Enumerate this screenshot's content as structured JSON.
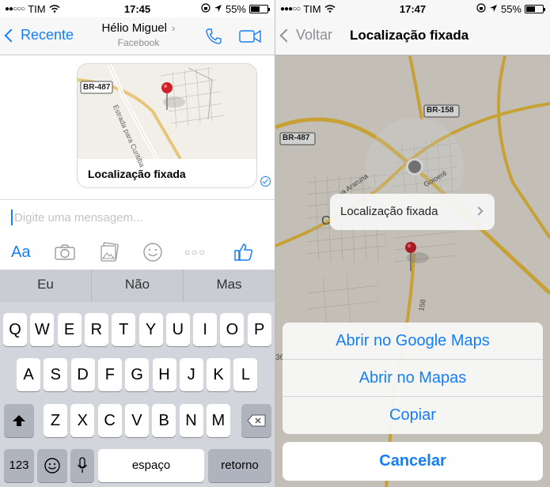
{
  "left": {
    "status": {
      "carrier": "TIM",
      "signal_dots": "●●○○○",
      "time": "17:45",
      "battery": "55%",
      "battery_level": 0.55
    },
    "nav": {
      "back_label": "Recente",
      "contact_name": "Hélio Miguel",
      "contact_sub": "Facebook"
    },
    "message": {
      "map_road_label": "BR-487",
      "map_street_label": "Estrada para Curitiba",
      "caption": "Localização fixada"
    },
    "composer": {
      "placeholder": "Digite uma mensagem..."
    },
    "tools": {
      "text_label": "Aa",
      "more_label": "○○○"
    },
    "keyboard": {
      "suggestions": [
        "Eu",
        "Não",
        "Mas"
      ],
      "row1": [
        "Q",
        "W",
        "E",
        "R",
        "T",
        "Y",
        "U",
        "I",
        "O",
        "P"
      ],
      "row2": [
        "A",
        "S",
        "D",
        "F",
        "G",
        "H",
        "J",
        "K",
        "L"
      ],
      "row3": [
        "Z",
        "X",
        "C",
        "V",
        "B",
        "N",
        "M"
      ],
      "numbers_label": "123",
      "space_label": "espaço",
      "return_label": "retorno"
    }
  },
  "right": {
    "status": {
      "carrier": "TIM",
      "signal_dots": "●●●○○",
      "time": "17:47",
      "battery": "55%",
      "battery_level": 0.55
    },
    "nav": {
      "back_label": "Voltar",
      "title": "Localização fixada"
    },
    "map": {
      "road1": "BR-158",
      "road2": "BR-487",
      "street": "Rua Araruna",
      "district": "Goioerê",
      "road3": "158",
      "town_initial": "C",
      "edge_label": "36"
    },
    "callout": "Localização fixada",
    "sheet": {
      "options": [
        "Abrir no Google Maps",
        "Abrir no Mapas",
        "Copiar"
      ],
      "cancel": "Cancelar"
    }
  },
  "colors": {
    "accent": "#157efb",
    "pin": "#d0202a",
    "road": "#f4c542"
  }
}
